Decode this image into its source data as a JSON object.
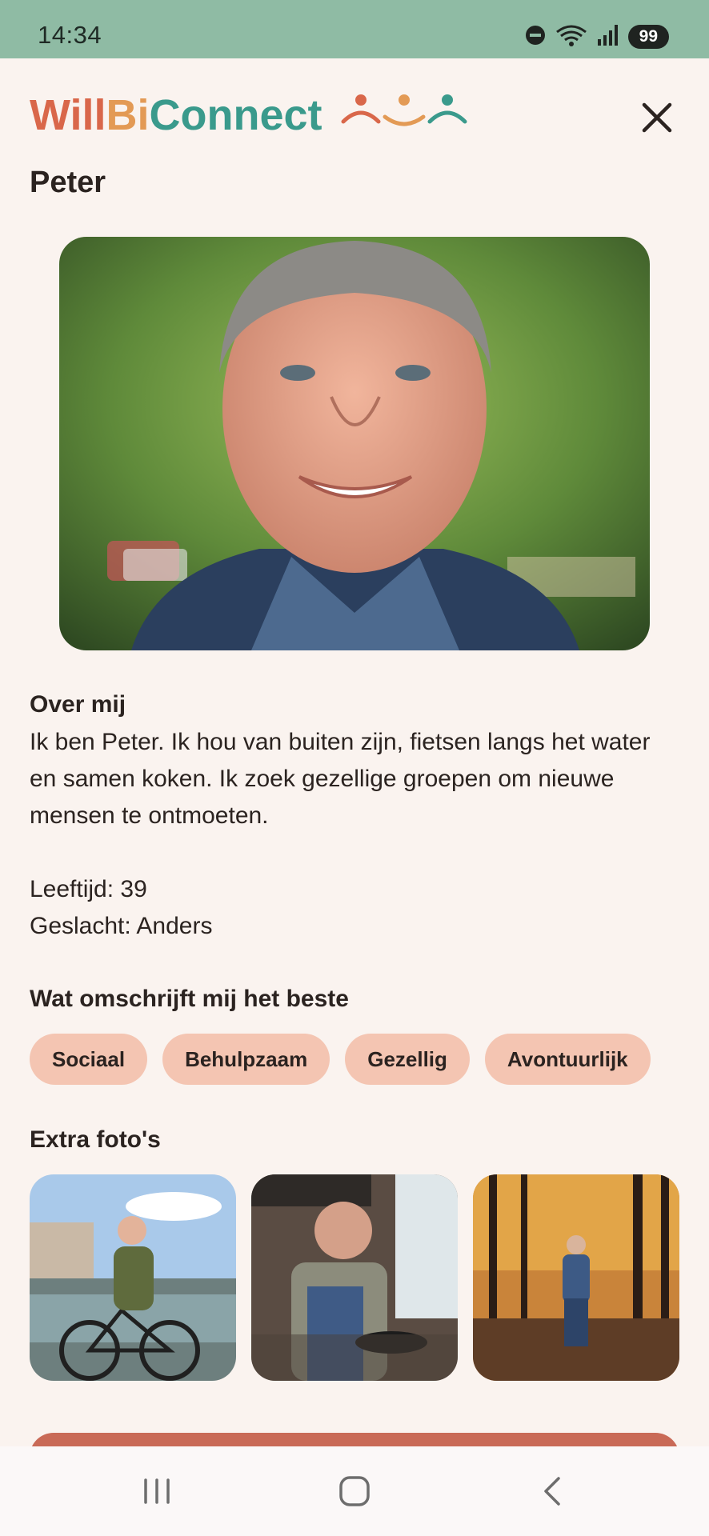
{
  "status_bar": {
    "time": "14:34",
    "battery": "99",
    "icons": [
      "do-not-disturb-icon",
      "wifi-icon",
      "signal-icon",
      "battery-icon"
    ]
  },
  "header": {
    "logo_parts": [
      "Will",
      "Bi",
      "Connect"
    ],
    "close_icon": "close-icon"
  },
  "profile": {
    "name": "Peter",
    "about_title": "Over mij",
    "about_text": "Ik ben Peter. Ik hou van buiten zijn, fietsen langs het water en samen koken. Ik zoek gezellige groepen om nieuwe mensen te ontmoeten.",
    "age": "Leeftijd: 39",
    "gender": "Geslacht: Anders",
    "traits_title": "Wat omschrijft mij het beste",
    "traits": [
      "Sociaal",
      "Behulpzaam",
      "Gezellig",
      "Avontuurlijk"
    ],
    "photos_title": "Extra foto's"
  },
  "nav": {
    "icons": [
      "recent-apps-icon",
      "home-icon",
      "back-icon"
    ]
  },
  "colors": {
    "status_bar": "#8fbba4",
    "background": "#faf3ef",
    "chip": "#f4c5b2",
    "cta": "#c96a57",
    "logo_orange": "#d9674a",
    "logo_teal": "#3a9a8c"
  }
}
